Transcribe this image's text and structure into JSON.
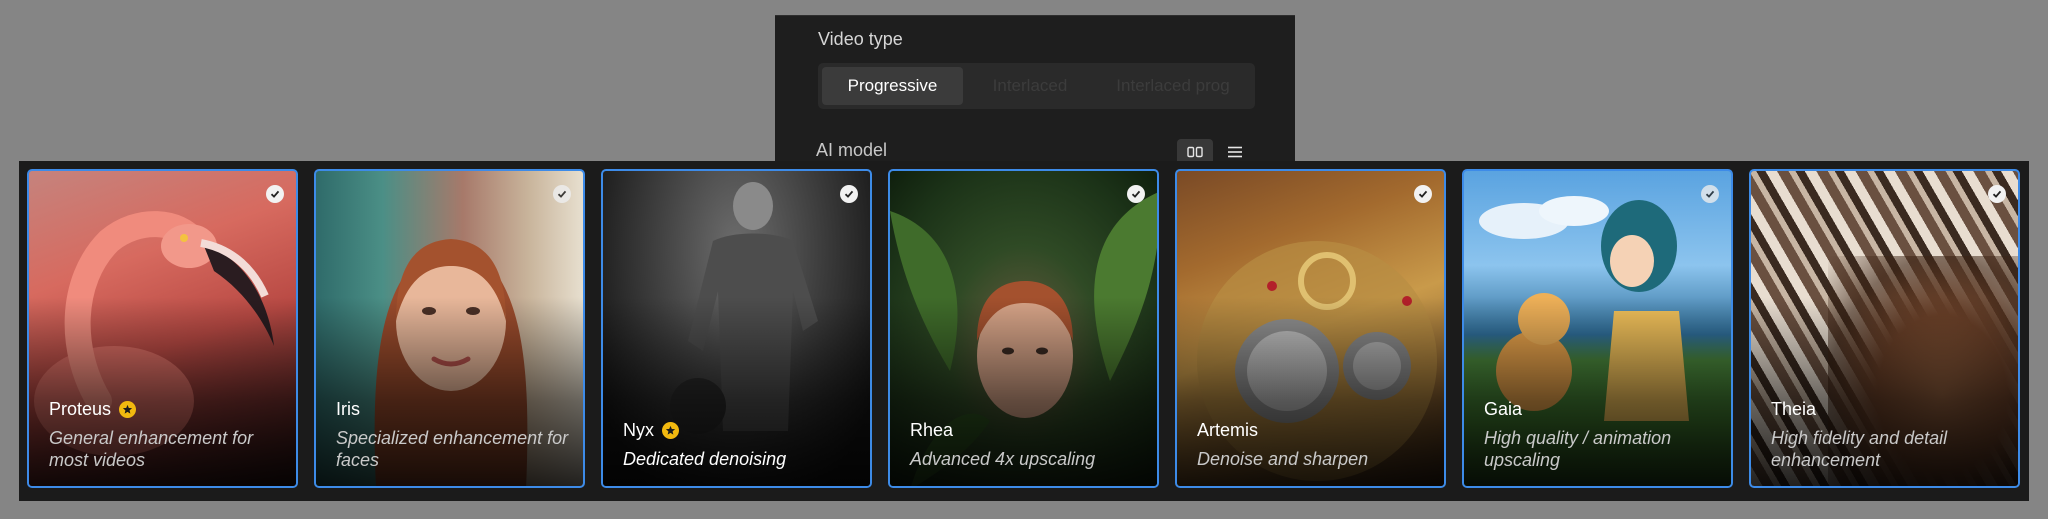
{
  "video_type": {
    "label": "Video type",
    "options": [
      "Progressive",
      "Interlaced",
      "Interlaced prog"
    ],
    "selected": "Progressive"
  },
  "ai_model": {
    "label": "AI model",
    "view_modes": [
      "grid-icon",
      "list-icon"
    ],
    "selected_view": "grid"
  },
  "models": [
    {
      "name": "Proteus",
      "description": "General enhancement for most videos",
      "featured": true
    },
    {
      "name": "Iris",
      "description": "Specialized enhancement for faces",
      "featured": false
    },
    {
      "name": "Nyx",
      "description": "Dedicated denoising",
      "featured": true
    },
    {
      "name": "Rhea",
      "description": "Advanced 4x upscaling",
      "featured": false
    },
    {
      "name": "Artemis",
      "description": "Denoise and sharpen",
      "featured": false
    },
    {
      "name": "Gaia",
      "description": "High quality / animation upscaling",
      "featured": false
    },
    {
      "name": "Theia",
      "description": "High fidelity and detail enhancement",
      "featured": false
    }
  ],
  "colors": {
    "selection_border": "#3d8be8",
    "featured_star": "#f2b90f",
    "panel_bg": "#1e1e1e"
  }
}
